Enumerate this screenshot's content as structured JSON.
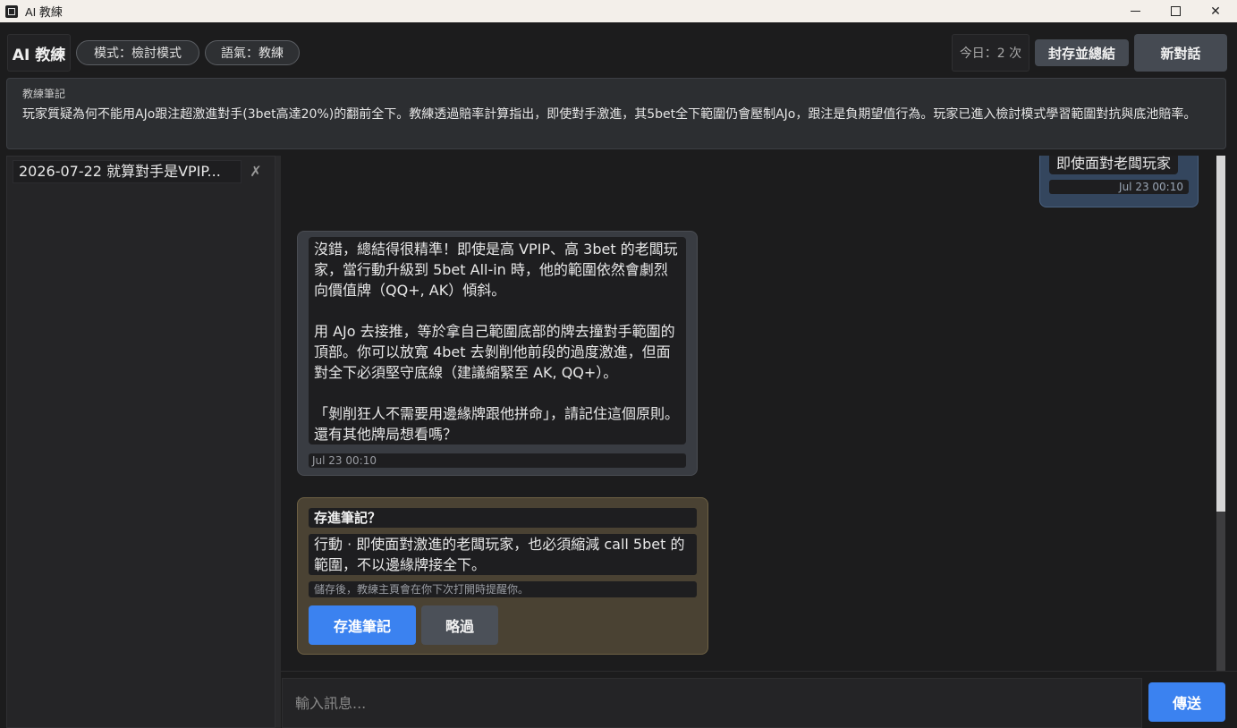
{
  "window": {
    "title": "AI 教練"
  },
  "header": {
    "brand": "AI 教練",
    "mode_pill": "模式：檢討模式",
    "tone_pill": "語氣：教練",
    "today_count": "今日：2 次",
    "archive_button": "封存並總結",
    "new_chat_button": "新對話"
  },
  "notes": {
    "label": "教練筆記",
    "text": "玩家質疑為何不能用AJo跟注超激進對手(3bet高達20%)的翻前全下。教練透過賠率計算指出，即使對手激進，其5bet全下範圍仍會壓制AJo，跟注是負期望值行為。玩家已進入檢討模式學習範圍對抗與底池賠率。"
  },
  "sidebar": {
    "sessions": [
      {
        "label": "2026-07-22  就算對手是VPIP...",
        "delete": "✗"
      }
    ]
  },
  "messages": {
    "user": {
      "text": "即使面對老闆玩家",
      "time": "Jul 23 00:10"
    },
    "ai": {
      "paragraphs": [
        "沒錯，總結得很精準！即使是高 VPIP、高 3bet 的老闆玩家，當行動升級到 5bet All-in 時，他的範圍依然會劇烈向價值牌（QQ+, AK）傾斜。",
        "用 AJo 去接推，等於拿自己範圍底部的牌去撞對手範圍的頂部。你可以放寬 4bet 去剝削他前段的過度激進，但面對全下必須堅守底線（建議縮緊至 AK, QQ+）。",
        "「剝削狂人不需要用邊緣牌跟他拼命」，請記住這個原則。還有其他牌局想看嗎？"
      ],
      "time": "Jul 23 00:10"
    }
  },
  "save_card": {
    "title": "存進筆記？",
    "body": "行動 · 即使面對激進的老闆玩家，也必須縮減 call 5bet 的範圍，不以邊緣牌接全下。",
    "hint": "儲存後，教練主頁會在你下次打開時提醒你。",
    "save_button": "存進筆記",
    "skip_button": "略過"
  },
  "composer": {
    "placeholder": "輸入訊息...",
    "send_button": "傳送"
  },
  "colors": {
    "accent": "#3b82f0",
    "background": "#1c1c1d",
    "user_bubble": "#34465e",
    "ai_bubble": "#393c42",
    "save_card": "#4a4233"
  }
}
